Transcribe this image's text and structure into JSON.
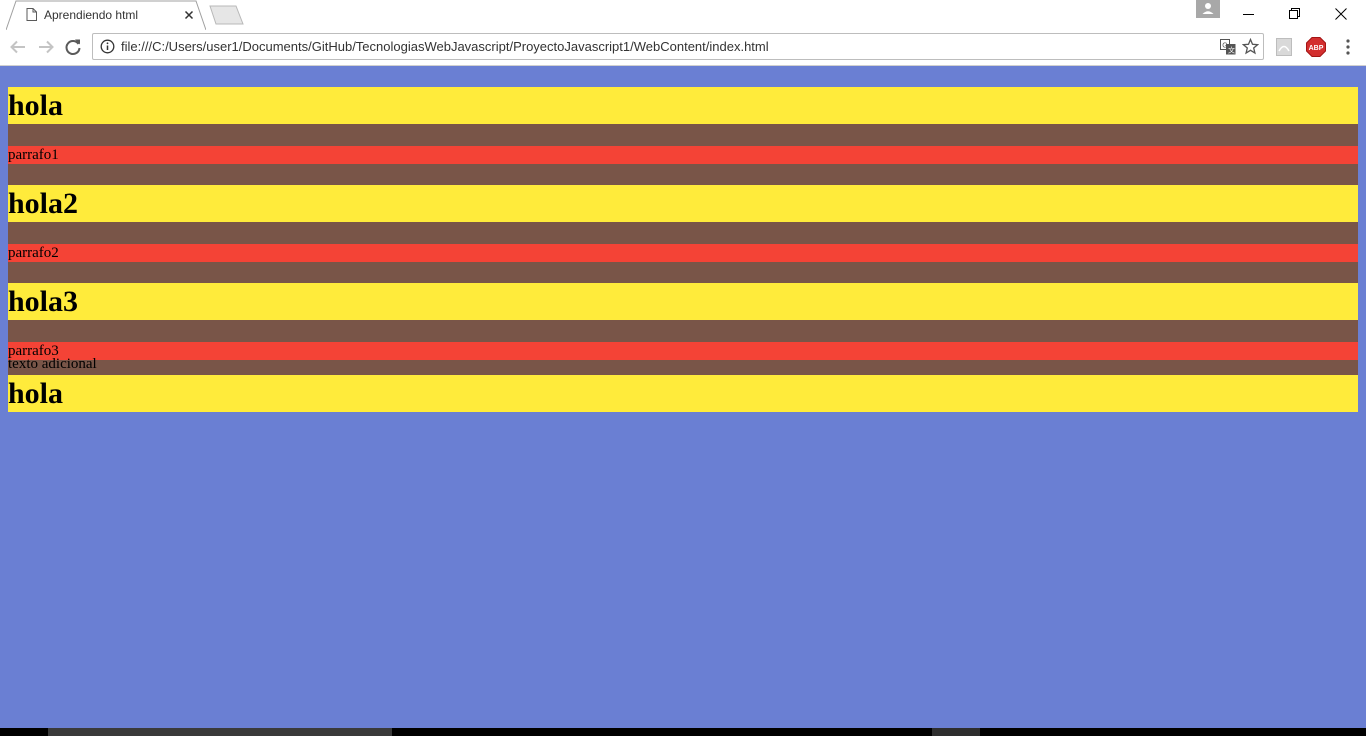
{
  "browser": {
    "tab": {
      "title": "Aprendiendo html",
      "page_icon": "page-icon",
      "close_icon": "close-icon"
    },
    "omnibox": {
      "url": "file:///C:/Users/user1/Documents/GitHub/TecnologiasWebJavascript/ProyectoJavascript1/WebContent/index.html",
      "info_icon": "info-icon",
      "translate_icon": "translate-icon",
      "star_icon": "star-icon"
    },
    "extensions": [
      "pdf-icon",
      "adblock-plus-icon"
    ]
  },
  "colors": {
    "page_background": "#6a7fd3",
    "heading_background": "#ffeb3b",
    "section_background": "#795548",
    "paragraph_background": "#f44336"
  },
  "page": {
    "sections": [
      {
        "heading": "hola",
        "paragraph": "parrafo1"
      },
      {
        "heading": "hola2",
        "paragraph": "parrafo2"
      },
      {
        "heading": "hola3",
        "paragraph": "parrafo3"
      }
    ],
    "extra_text": "texto adicional",
    "final_heading": "hola"
  }
}
